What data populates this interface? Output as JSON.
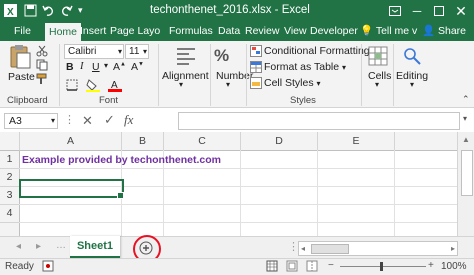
{
  "window": {
    "title": "techonthenet_2016.xlsx - Excel"
  },
  "tabs": [
    "File",
    "Home",
    "Insert",
    "Page Layo",
    "Formulas",
    "Data",
    "Review",
    "View",
    "Developer"
  ],
  "tell_me": "Tell me v",
  "share": "Share",
  "ribbon": {
    "paste": "Paste",
    "clipboard": "Clipboard",
    "font_name": "Calibri",
    "font_size": "11",
    "font_group": "Font",
    "alignment": "Alignment",
    "number": "Number",
    "conditional_formatting": "Conditional Formatting",
    "format_as_table": "Format as Table",
    "cell_styles": "Cell Styles",
    "styles": "Styles",
    "cells": "Cells",
    "editing": "Editing"
  },
  "formula_bar": {
    "name_box": "A3",
    "fx": "fx",
    "value": ""
  },
  "columns": [
    "A",
    "B",
    "C",
    "D",
    "E"
  ],
  "rows": [
    "1",
    "2",
    "3",
    "4"
  ],
  "cells": {
    "A1": "Example provided by techonthenet.com"
  },
  "sheet_tabs": [
    "Sheet1"
  ],
  "status": {
    "ready": "Ready",
    "zoom": "100%"
  },
  "colors": {
    "excel_green": "#217346",
    "cell_text": "#7030a0",
    "highlight": "#e81123"
  }
}
